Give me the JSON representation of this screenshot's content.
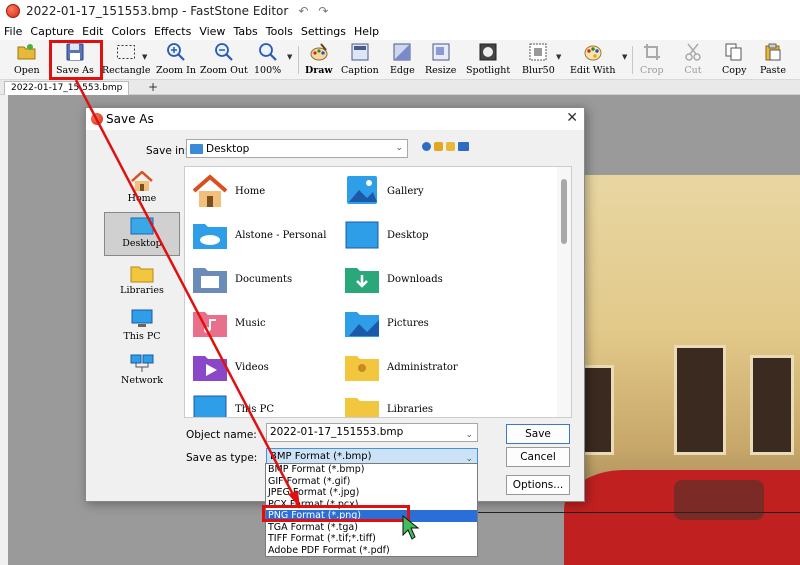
{
  "window": {
    "title": "2022-01-17_151553.bmp - FastStone Editor"
  },
  "menu": [
    "File",
    "Capture",
    "Edit",
    "Colors",
    "Effects",
    "View",
    "Tabs",
    "Tools",
    "Settings",
    "Help"
  ],
  "toolbar": {
    "open": "Open",
    "save_as": "Save As",
    "rectangle": "Rectangle",
    "zoom_in": "Zoom In",
    "zoom_out": "Zoom Out",
    "zoom_level": "100%",
    "draw": "Draw",
    "caption": "Caption",
    "edge": "Edge",
    "resize": "Resize",
    "spotlight": "Spotlight",
    "blur": "Blur50",
    "edit_with": "Edit With",
    "crop": "Crop",
    "cut": "Cut",
    "copy": "Copy",
    "paste": "Paste"
  },
  "tab": {
    "label": "2022-01-17_15.553.bmp",
    "add": "+"
  },
  "dialog": {
    "title": "Save As",
    "save_in_label": "Save in:",
    "save_in_value": "Desktop",
    "places": [
      "Home",
      "Desktop",
      "Libraries",
      "This PC",
      "Network"
    ],
    "files": [
      "Home",
      "Gallery",
      "Alstone - Personal",
      "Desktop",
      "Documents",
      "Downloads",
      "Music",
      "Pictures",
      "Videos",
      "Administrator",
      "This PC",
      "Libraries"
    ],
    "object_name_label": "Object name:",
    "object_name_value": "2022-01-17_151553.bmp",
    "type_label": "Save as type:",
    "type_value": "BMP Format (*.bmp)",
    "save_btn": "Save",
    "cancel_btn": "Cancel",
    "options_btn": "Options...",
    "type_options": [
      "BMP Format (*.bmp)",
      "GIF Format (*.gif)",
      "JPEG Format (*.jpg)",
      "PCX Format (*.pcx)",
      "PNG Format (*.png)",
      "TGA Format (*.tga)",
      "TIFF Format (*.tif;*.tiff)",
      "Adobe PDF Format (*.pdf)"
    ],
    "highlighted_option": "PNG Format (*.png)"
  },
  "colors": {
    "annotation": "#e01010",
    "selection": "#2a6fd8",
    "accent": "#3b8ad8"
  }
}
